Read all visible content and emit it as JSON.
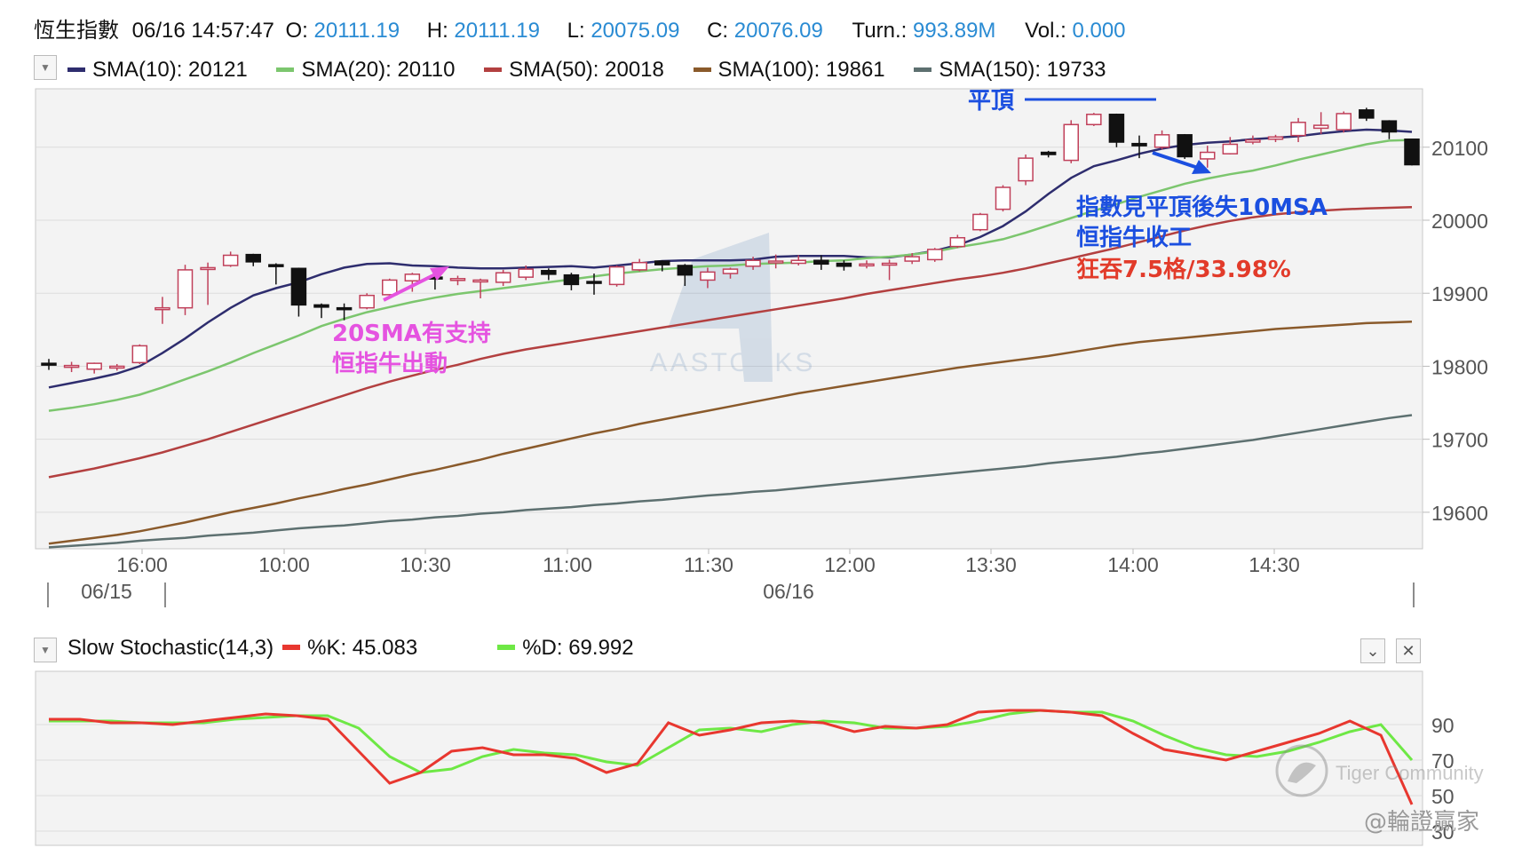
{
  "header": {
    "title": "恆生指數",
    "datetime": "06/16 14:57:47",
    "open_label": "O:",
    "open": "20111.19",
    "high_label": "H:",
    "high": "20111.19",
    "low_label": "L:",
    "low": "20075.09",
    "close_label": "C:",
    "close": "20076.09",
    "turn_label": "Turn.:",
    "turn": "993.89M",
    "vol_label": "Vol.:",
    "vol": "0.000"
  },
  "legend": [
    {
      "label": "SMA(10): 20121",
      "color": "#2e2d6e"
    },
    {
      "label": "SMA(20): 20110",
      "color": "#7cc66e"
    },
    {
      "label": "SMA(50): 20018",
      "color": "#b34040"
    },
    {
      "label": "SMA(100): 19861",
      "color": "#8a5a2b"
    },
    {
      "label": "SMA(150): 19733",
      "color": "#5d7070"
    }
  ],
  "watermark": "AASTOCKS",
  "annotations": {
    "flat_top": "平頂",
    "blue_line1": "指數見平頂後失10MSA",
    "blue_line2": "恒指牛收工",
    "red_line": "狂吞7.5格/33.98%",
    "pink_line1": "20SMA有支持",
    "pink_line2": "恒指牛出動"
  },
  "stoch": {
    "title": "Slow Stochastic(14,3)",
    "k_label": "%K: 45.083",
    "d_label": "%D: 69.992",
    "k_color": "#e8372f",
    "d_color": "#6ee845"
  },
  "footer": {
    "brand": "Tiger Community",
    "handle": "@輪證贏家"
  },
  "chart_data": [
    {
      "type": "candlestick",
      "ylim": [
        19550,
        20180
      ],
      "yticks": [
        19600,
        19700,
        19800,
        19900,
        20000,
        20100
      ],
      "xticks": [
        "16:00",
        "10:00",
        "10:30",
        "11:00",
        "11:30",
        "12:00",
        "13:30",
        "14:00",
        "14:30"
      ],
      "date_labels": [
        "06/15",
        "06/16"
      ],
      "ohlc": [
        [
          19804,
          19810,
          19795,
          19802
        ],
        [
          19800,
          19806,
          19792,
          19801
        ],
        [
          19796,
          19805,
          19790,
          19804
        ],
        [
          19798,
          19803,
          19794,
          19800
        ],
        [
          19805,
          19830,
          19803,
          19828
        ],
        [
          19878,
          19895,
          19858,
          19880
        ],
        [
          19880,
          19939,
          19870,
          19932
        ],
        [
          19935,
          19942,
          19884,
          19935
        ],
        [
          19938,
          19957,
          19936,
          19952
        ],
        [
          19953,
          19954,
          19937,
          19943
        ],
        [
          19939,
          19941,
          19912,
          19937
        ],
        [
          19934,
          19935,
          19868,
          19884
        ],
        [
          19884,
          19886,
          19866,
          19881
        ],
        [
          19880,
          19886,
          19863,
          19878
        ],
        [
          19880,
          19900,
          19878,
          19897
        ],
        [
          19898,
          19920,
          19894,
          19918
        ],
        [
          19917,
          19928,
          19902,
          19926
        ],
        [
          19922,
          19928,
          19905,
          19920
        ],
        [
          19919,
          19924,
          19911,
          19920
        ],
        [
          19916,
          19920,
          19893,
          19918
        ],
        [
          19915,
          19932,
          19910,
          19928
        ],
        [
          19922,
          19938,
          19918,
          19933
        ],
        [
          19931,
          19934,
          19918,
          19926
        ],
        [
          19925,
          19928,
          19904,
          19912
        ],
        [
          19916,
          19927,
          19898,
          19914
        ],
        [
          19912,
          19938,
          19909,
          19936
        ],
        [
          19932,
          19947,
          19930,
          19942
        ],
        [
          19944,
          19945,
          19930,
          19939
        ],
        [
          19938,
          19940,
          19910,
          19925
        ],
        [
          19918,
          19935,
          19907,
          19929
        ],
        [
          19927,
          19935,
          19920,
          19933
        ],
        [
          19937,
          19950,
          19932,
          19945
        ],
        [
          19943,
          19953,
          19934,
          19944
        ],
        [
          19941,
          19952,
          19938,
          19945
        ],
        [
          19945,
          19952,
          19932,
          19940
        ],
        [
          19941,
          19945,
          19931,
          19937
        ],
        [
          19939,
          19945,
          19934,
          19940
        ],
        [
          19939,
          19946,
          19918,
          19941
        ],
        [
          19944,
          19955,
          19940,
          19950
        ],
        [
          19946,
          19962,
          19943,
          19960
        ],
        [
          19964,
          19980,
          19962,
          19976
        ],
        [
          19987,
          20010,
          19985,
          20008
        ],
        [
          20015,
          20048,
          20012,
          20045
        ],
        [
          20054,
          20090,
          20048,
          20085
        ],
        [
          20093,
          20095,
          20086,
          20090
        ],
        [
          20082,
          20137,
          20078,
          20131
        ],
        [
          20131,
          20147,
          20129,
          20145
        ],
        [
          20145,
          20146,
          20100,
          20107
        ],
        [
          20105,
          20116,
          20085,
          20102
        ],
        [
          20100,
          20123,
          20097,
          20117
        ],
        [
          20117,
          20118,
          20084,
          20087
        ],
        [
          20084,
          20102,
          20072,
          20093
        ],
        [
          20091,
          20114,
          20090,
          20104
        ],
        [
          20107,
          20116,
          20104,
          20110
        ],
        [
          20111,
          20117,
          20107,
          20114
        ],
        [
          20116,
          20140,
          20107,
          20134
        ],
        [
          20126,
          20148,
          20118,
          20130
        ],
        [
          20124,
          20149,
          20120,
          20146
        ],
        [
          20151,
          20154,
          20136,
          20140
        ],
        [
          20136,
          20137,
          20111,
          20121
        ],
        [
          20111,
          20111,
          20075,
          20076
        ]
      ],
      "series": [
        {
          "name": "SMA(10)",
          "values": [
            19771,
            19777,
            19783,
            19790,
            19800,
            19818,
            19838,
            19860,
            19880,
            19897,
            19907,
            19915,
            19926,
            19935,
            19940,
            19941,
            19938,
            19937,
            19935,
            19934,
            19934,
            19935,
            19936,
            19937,
            19935,
            19938,
            19941,
            19944,
            19945,
            19945,
            19945,
            19946,
            19950,
            19951,
            19951,
            19951,
            19949,
            19949,
            19953,
            19958,
            19966,
            19977,
            19992,
            20012,
            20036,
            20058,
            20074,
            20082,
            20091,
            20098,
            20103,
            20106,
            20108,
            20111,
            20113,
            20115,
            20119,
            20122,
            20124,
            20123,
            20121
          ]
        },
        {
          "name": "SMA(20)",
          "values": [
            19739,
            19743,
            19748,
            19754,
            19761,
            19771,
            19782,
            19793,
            19805,
            19818,
            19830,
            19842,
            19855,
            19865,
            19874,
            19881,
            19888,
            19894,
            19899,
            19903,
            19907,
            19911,
            19915,
            19919,
            19923,
            19927,
            19930,
            19933,
            19935,
            19937,
            19938,
            19940,
            19941,
            19942,
            19944,
            19945,
            19948,
            19950,
            19953,
            19957,
            19963,
            19968,
            19974,
            19983,
            19993,
            20003,
            20013,
            20022,
            20032,
            20041,
            20050,
            20057,
            20063,
            20068,
            20075,
            20083,
            20090,
            20097,
            20104,
            20109,
            20110
          ]
        },
        {
          "name": "SMA(50)",
          "values": [
            19648,
            19654,
            19660,
            19667,
            19674,
            19682,
            19691,
            19700,
            19710,
            19720,
            19730,
            19740,
            19750,
            19760,
            19770,
            19779,
            19787,
            19795,
            19802,
            19810,
            19817,
            19823,
            19828,
            19833,
            19838,
            19843,
            19848,
            19853,
            19858,
            19863,
            19868,
            19873,
            19878,
            19883,
            19888,
            19893,
            19899,
            19904,
            19909,
            19914,
            19919,
            19923,
            19928,
            19934,
            19941,
            19948,
            19955,
            19962,
            19970,
            19978,
            19986,
            19993,
            19999,
            20004,
            20008,
            20011,
            20013,
            20015,
            20016,
            20017,
            20018
          ]
        },
        {
          "name": "SMA(100)",
          "values": [
            19557,
            19561,
            19565,
            19569,
            19574,
            19580,
            19586,
            19593,
            19600,
            19606,
            19612,
            19619,
            19625,
            19632,
            19638,
            19645,
            19652,
            19658,
            19665,
            19672,
            19680,
            19687,
            19694,
            19701,
            19708,
            19714,
            19721,
            19727,
            19733,
            19739,
            19745,
            19751,
            19757,
            19763,
            19768,
            19773,
            19778,
            19783,
            19788,
            19793,
            19798,
            19802,
            19806,
            19810,
            19814,
            19819,
            19824,
            19829,
            19833,
            19836,
            19839,
            19842,
            19845,
            19848,
            19851,
            19853,
            19855,
            19857,
            19859,
            19860,
            19861
          ]
        },
        {
          "name": "SMA(150)",
          "values": [
            19552,
            19554,
            19556,
            19558,
            19561,
            19563,
            19565,
            19568,
            19570,
            19572,
            19575,
            19578,
            19580,
            19582,
            19585,
            19588,
            19590,
            19593,
            19595,
            19598,
            19600,
            19603,
            19605,
            19607,
            19610,
            19612,
            19615,
            19617,
            19620,
            19623,
            19625,
            19628,
            19630,
            19633,
            19636,
            19639,
            19642,
            19645,
            19648,
            19651,
            19654,
            19657,
            19660,
            19663,
            19667,
            19670,
            19673,
            19676,
            19680,
            19683,
            19687,
            19691,
            19695,
            19699,
            19704,
            19709,
            19714,
            19719,
            19724,
            19729,
            19733
          ]
        }
      ]
    },
    {
      "type": "line",
      "ylim": [
        0,
        100
      ],
      "yticks": [
        30,
        50,
        70,
        90
      ],
      "series": [
        {
          "name": "%K",
          "values": [
            93,
            93,
            91,
            91,
            90,
            92,
            94,
            96,
            95,
            93,
            75,
            57,
            63,
            75,
            77,
            73,
            73,
            71,
            63,
            68,
            91,
            84,
            87,
            91,
            92,
            91,
            86,
            89,
            88,
            90,
            97,
            98,
            98,
            97,
            95,
            85,
            76,
            73,
            70,
            75,
            80,
            85,
            92,
            84,
            45
          ]
        },
        {
          "name": "%D",
          "values": [
            92,
            92,
            92,
            91,
            91,
            91,
            93,
            94,
            95,
            95,
            88,
            72,
            63,
            65,
            72,
            76,
            74,
            73,
            69,
            67,
            77,
            87,
            88,
            86,
            90,
            92,
            91,
            88,
            88,
            89,
            92,
            96,
            98,
            97,
            97,
            92,
            84,
            77,
            73,
            72,
            75,
            80,
            86,
            90,
            70
          ]
        }
      ]
    }
  ]
}
